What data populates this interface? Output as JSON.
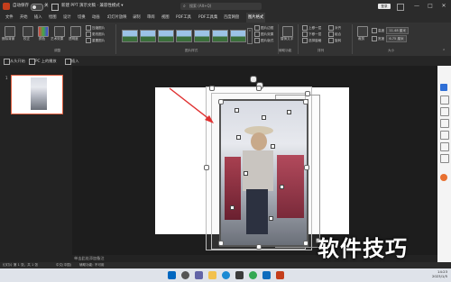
{
  "titlebar": {
    "autosave_label": "自动保存",
    "autosave_state": "关",
    "doc_title": "新建 PPT 演示文稿 · 兼容性模式 ▾",
    "search_placeholder": "搜索 (Alt+Q)",
    "login_label": "登录",
    "minimize": "—",
    "maximize": "□",
    "close": "✕"
  },
  "tabs": [
    "文件",
    "开始",
    "插入",
    "绘图",
    "设计",
    "切换",
    "动画",
    "幻灯片放映",
    "录制",
    "审阅",
    "视图",
    "PDF工具",
    "PDF工具集",
    "百度网盘",
    "图片格式"
  ],
  "active_tab": "图片格式",
  "ribbon": {
    "groups": [
      {
        "label": "调整"
      },
      {
        "label": "图片样式"
      },
      {
        "label": "辅助功能"
      },
      {
        "label": "排列"
      },
      {
        "label": "大小"
      }
    ],
    "adjust_buttons": [
      "删除背景",
      "校正",
      "颜色",
      "艺术效果",
      "透明度"
    ],
    "adjust_small": [
      "压缩图片",
      "更改图片",
      "重置图片"
    ],
    "style_small": [
      "图片边框",
      "图片效果",
      "图片版式"
    ],
    "accessibility": "替换文字",
    "arrange_small": [
      "上移一层",
      "下移一层",
      "选择窗格"
    ],
    "arrange_right": [
      "对齐",
      "组合",
      "旋转"
    ],
    "crop": "裁剪",
    "size": {
      "height_label": "高度",
      "height_value": "11.48 厘米",
      "width_label": "宽度",
      "width_value": "6.75 厘米"
    }
  },
  "quickbar": {
    "from_start": "从头开始",
    "from_current": "PC 上的播放",
    "extra": "插入"
  },
  "slide_panel": {
    "slide_number": "1"
  },
  "notes": {
    "placeholder": "单击此处添加备注"
  },
  "statusbar": {
    "slide_info": "幻灯片 第 1 张，共 1 张",
    "language": "中文(中国)",
    "accessibility": "辅助功能: 不可用"
  },
  "taskbar": {
    "time": "14:23",
    "date": "2023/1/5",
    "icons": [
      {
        "name": "windows-start-icon",
        "color": "#0067c0"
      },
      {
        "name": "search-icon",
        "color": "#555555"
      },
      {
        "name": "chat-icon",
        "color": "#6264a7"
      },
      {
        "name": "file-explorer-icon",
        "color": "#f2c14e"
      },
      {
        "name": "edge-icon",
        "color": "#1a8ad4"
      },
      {
        "name": "store-icon",
        "color": "#3a3a3a"
      },
      {
        "name": "chrome-icon",
        "color": "#34a853"
      },
      {
        "name": "mail-icon",
        "color": "#0f6cbd"
      },
      {
        "name": "powerpoint-icon",
        "color": "#c43e1c"
      }
    ]
  },
  "watermark": "软件技巧",
  "accent_color": "#f07040"
}
